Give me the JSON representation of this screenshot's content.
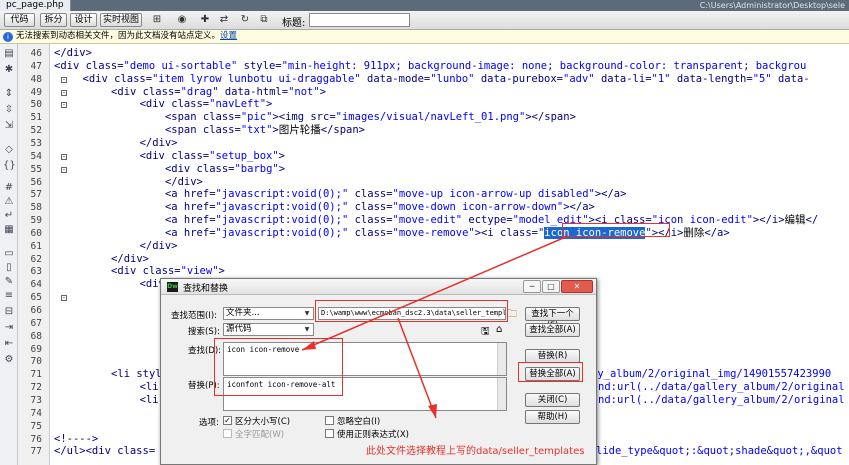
{
  "window": {
    "tab": "pc_page.php",
    "path": "C:\\Users\\Administrator\\Desktop\\sele"
  },
  "toolbar": {
    "buttons": [
      "代码",
      "拆分",
      "设计",
      "实时视图"
    ],
    "title_label": "标题:",
    "title_value": ""
  },
  "infobar": {
    "text": "无法搜索到动态相关文件，因为此文档没有站点定义。",
    "link": "设置"
  },
  "line_numbers": [
    "46",
    "47",
    "48",
    "49",
    "50",
    "51",
    "52",
    "53",
    "54",
    "55",
    "56",
    "57",
    "58",
    "59",
    "60",
    "61",
    "62",
    "63",
    "64",
    "65",
    "66",
    "67",
    "68",
    "69",
    "70",
    "71",
    "72",
    "73",
    "74",
    "75",
    "76",
    "77"
  ],
  "code": {
    "l46": [
      [
        "tg",
        "</div>"
      ]
    ],
    "l47": [
      [
        "tg",
        "<div "
      ],
      [
        "at",
        "class="
      ],
      [
        "vl",
        "\"demo ui-sortable\""
      ],
      [
        "at",
        " style="
      ],
      [
        "vl",
        "\"min-height: 911px; background-image: none; background-color: transparent; backgrou"
      ]
    ],
    "l48": [
      [
        "tg",
        "<div "
      ],
      [
        "at",
        "class="
      ],
      [
        "vl",
        "\"item lyrow lunbotu ui-draggable\""
      ],
      [
        "at",
        " data-mode="
      ],
      [
        "vl",
        "\"lunbo\""
      ],
      [
        "at",
        " data-purebox="
      ],
      [
        "vl",
        "\"adv\""
      ],
      [
        "at",
        " data-li="
      ],
      [
        "vl",
        "\"1\""
      ],
      [
        "at",
        " data-length="
      ],
      [
        "vl",
        "\"5\""
      ],
      [
        "at",
        " data-"
      ]
    ],
    "l49": [
      [
        "tg",
        "<div "
      ],
      [
        "at",
        "class="
      ],
      [
        "vl",
        "\"drag\""
      ],
      [
        "at",
        " data-html="
      ],
      [
        "vl",
        "\"not\""
      ],
      [
        "tg",
        ">"
      ]
    ],
    "l50": [
      [
        "tg",
        "<div "
      ],
      [
        "at",
        "class="
      ],
      [
        "vl",
        "\"navLeft\""
      ],
      [
        "tg",
        ">"
      ]
    ],
    "l51": [
      [
        "tg",
        "<span "
      ],
      [
        "at",
        "class="
      ],
      [
        "vl",
        "\"pic\""
      ],
      [
        "tg",
        "><img "
      ],
      [
        "at",
        "src="
      ],
      [
        "vl",
        "\"images/visual/navLeft_01.png\""
      ],
      [
        "tg",
        "></span>"
      ]
    ],
    "l52": [
      [
        "tg",
        "<span "
      ],
      [
        "at",
        "class="
      ],
      [
        "vl",
        "\"txt\""
      ],
      [
        "tg",
        ">"
      ],
      [
        "tx",
        "图片轮播"
      ],
      [
        "tg",
        "</span>"
      ]
    ],
    "l53": [
      [
        "tg",
        "</div>"
      ]
    ],
    "l54": [
      [
        "tg",
        "<div "
      ],
      [
        "at",
        "class="
      ],
      [
        "vl",
        "\"setup_box\""
      ],
      [
        "tg",
        ">"
      ]
    ],
    "l55": [
      [
        "tg",
        "<div "
      ],
      [
        "at",
        "class="
      ],
      [
        "vl",
        "\"barbg\""
      ],
      [
        "tg",
        ">"
      ]
    ],
    "l56": [
      [
        "tg",
        "</div>"
      ]
    ],
    "l57": [
      [
        "tg",
        "<a "
      ],
      [
        "at",
        "href="
      ],
      [
        "vl",
        "\"javascript:void(0);\""
      ],
      [
        "at",
        " class="
      ],
      [
        "vl",
        "\"move-up icon-arrow-up disabled\""
      ],
      [
        "tg",
        "></a>"
      ]
    ],
    "l58": [
      [
        "tg",
        "<a "
      ],
      [
        "at",
        "href="
      ],
      [
        "vl",
        "\"javascript:void(0);\""
      ],
      [
        "at",
        " class="
      ],
      [
        "vl",
        "\"move-down icon-arrow-down\""
      ],
      [
        "tg",
        "></a>"
      ]
    ],
    "l59": [
      [
        "tg",
        "<a "
      ],
      [
        "at",
        "href="
      ],
      [
        "vl",
        "\"javascript:void(0);\""
      ],
      [
        "at",
        " class="
      ],
      [
        "vl",
        "\"move-edit\""
      ],
      [
        "at",
        " ectype="
      ],
      [
        "vl",
        "\"model_edit\""
      ],
      [
        "tg",
        "><i "
      ],
      [
        "at",
        "class="
      ],
      [
        "vl",
        "\"icon icon-edit\""
      ],
      [
        "tg",
        "></i>"
      ],
      [
        "tx",
        "编辑"
      ],
      [
        "tg",
        "</"
      ]
    ],
    "l60a": [
      [
        "tg",
        "<a "
      ],
      [
        "at",
        "href="
      ],
      [
        "vl",
        "\"javascript:void(0);\""
      ],
      [
        "at",
        " class="
      ],
      [
        "vl",
        "\"move-remove\""
      ],
      [
        "tg",
        "><i "
      ],
      [
        "at",
        "class="
      ],
      [
        "vl",
        "\""
      ]
    ],
    "l60sel": "icon icon-remove",
    "l60b": [
      [
        "vl",
        "\""
      ],
      [
        "tg",
        "></i>"
      ],
      [
        "tx",
        "删除"
      ],
      [
        "tg",
        "</a>"
      ]
    ],
    "l61": [
      [
        "tg",
        "</div>"
      ]
    ],
    "l62": [
      [
        "tg",
        "</div>"
      ]
    ],
    "l63": [
      [
        "tg",
        "<div "
      ],
      [
        "at",
        "class="
      ],
      [
        "vl",
        "\"view\""
      ],
      [
        "tg",
        ">"
      ]
    ],
    "l64": [
      [
        "tg",
        "<div"
      ]
    ],
    "l71a": [
      [
        "tg",
        "<li "
      ],
      [
        "at",
        "styl"
      ]
    ],
    "l71b": [
      [
        "vl",
        "ry_album/2/original_img/14901557423990"
      ]
    ],
    "l72a": [
      [
        "tg",
        "<li "
      ],
      [
        "at",
        "s"
      ]
    ],
    "l72b": [
      [
        "vl",
        "nd:url(../data/gallery_album/2/original"
      ]
    ],
    "l73a": [
      [
        "tg",
        "<li "
      ],
      [
        "at",
        "s"
      ]
    ],
    "l73b": [
      [
        "vl",
        "nd:url(../data/gallery_album/2/original"
      ]
    ],
    "l76": [
      [
        "tg",
        "<!---->"
      ]
    ],
    "l77a": [
      [
        "tg",
        "</ul><div "
      ],
      [
        "at",
        "class="
      ]
    ],
    "l77b": [
      [
        "vl",
        "lide_type&quot;:&quot;shade&quot;,&quot"
      ]
    ]
  },
  "dialog": {
    "title": "查找和替换",
    "scope_label": "查找范围(I):",
    "scope_value": "文件夹...",
    "folder_path": "D:\\wamp\\www\\ecmoban_dsc2.3\\data\\seller_templ",
    "search_label": "搜索(S):",
    "search_value": "源代码",
    "find_label": "查找(D):",
    "find_value": "icon icon-remove",
    "replace_label": "替换(P):",
    "replace_value": "iconfont icon-remove-alt",
    "options_label": "选项:",
    "opt_case": "区分大小写(C)",
    "opt_whole": "全字匹配(W)",
    "opt_ignore_ws": "忽略空白(I)",
    "opt_regex": "使用正则表达式(X)",
    "buttons": {
      "find_next": "查找下一个(F)",
      "find_all": "查找全部(A)",
      "replace": "替换(R)",
      "replace_all": "替换全部(A)",
      "close": "关闭(C)",
      "help": "帮助(H)"
    }
  },
  "annotation": "此处文件选择教程上写的data/seller_templates",
  "colors": {
    "annotation": "#e8302a",
    "selection": "#1c67d0"
  }
}
